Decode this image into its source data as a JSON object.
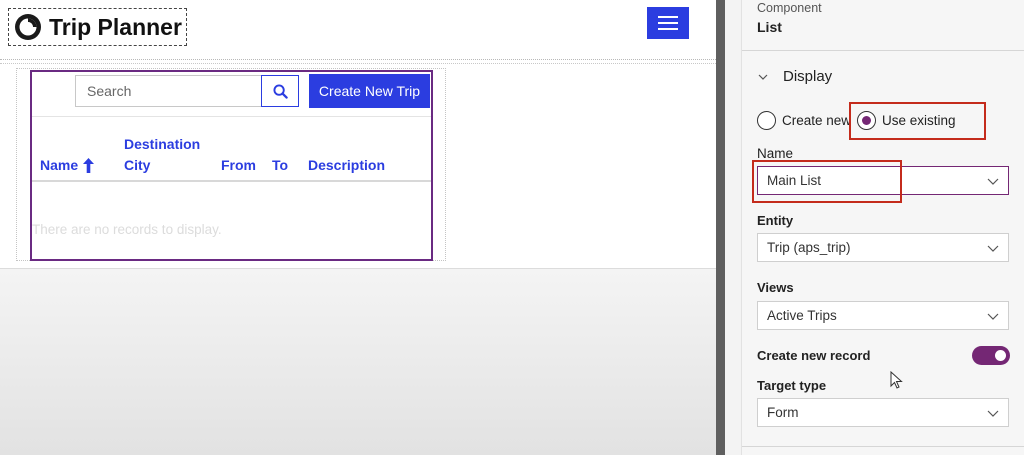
{
  "site": {
    "title": "Trip Planner",
    "logo_icon": "logo-ring-icon",
    "menu_icon": "hamburger-menu-icon",
    "accent_color": "#2b3de0"
  },
  "list": {
    "search_placeholder": "Search",
    "search_icon": "search-icon",
    "create_label": "Create New Trip",
    "columns": {
      "name": "Name",
      "destination_line1": "Destination",
      "destination_line2": "City",
      "from": "From",
      "to": "To",
      "description": "Description"
    },
    "sort_icon": "arrow-up-icon",
    "empty_message": "There are no records to display.",
    "frame_color": "#6a2a82"
  },
  "panel": {
    "component_label": "Component",
    "component_value": "List",
    "section_title": "Display",
    "radio_create": "Create new",
    "radio_existing": "Use existing",
    "radio_selected": "Use existing",
    "name_label": "Name",
    "name_value": "Main List",
    "entity_label": "Entity",
    "entity_value": "Trip (aps_trip)",
    "views_label": "Views",
    "views_value": "Active Trips",
    "create_record_label": "Create new record",
    "create_record_enabled": true,
    "target_type_label": "Target type",
    "target_type_value": "Form",
    "accent_color": "#742774",
    "highlight_color": "#c42b1c"
  }
}
